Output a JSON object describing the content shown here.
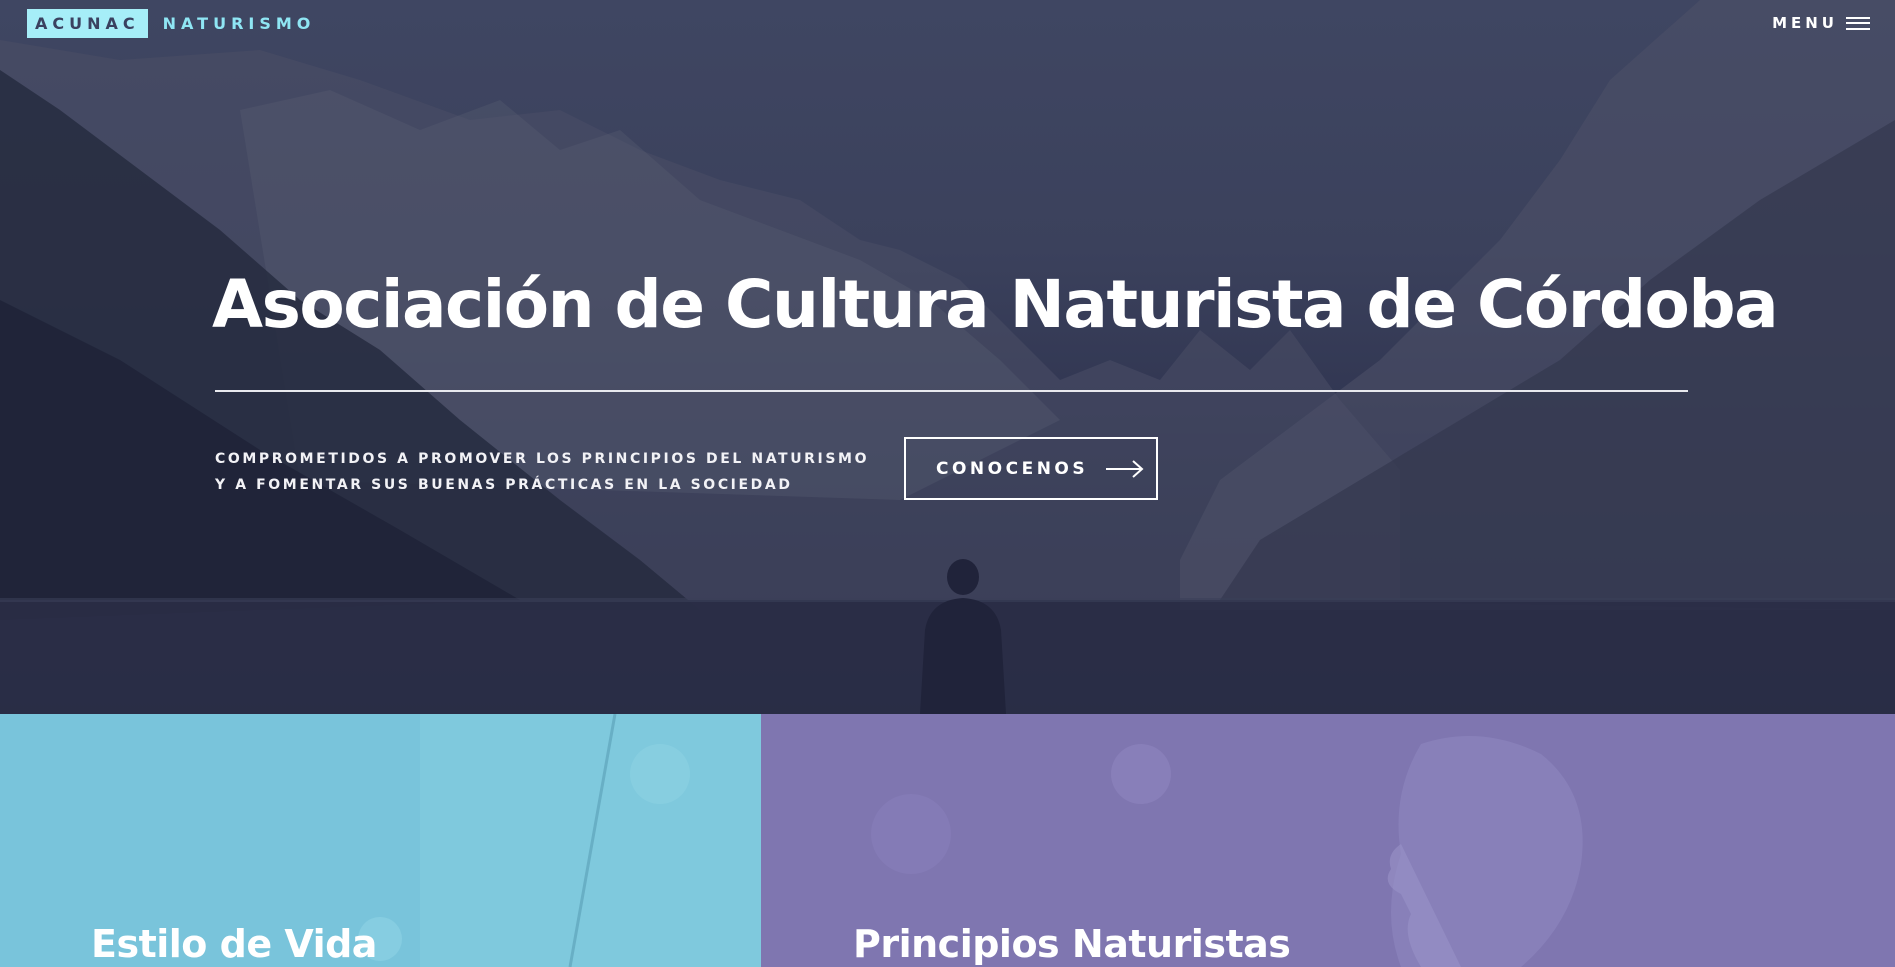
{
  "brand": {
    "box_text": "ACUNAC",
    "name": "NATURISMO"
  },
  "nav": {
    "menu_label": "MENU",
    "menu_icon": "hamburger-icon"
  },
  "hero": {
    "title": "Asociación de Cultura Naturista de Córdoba",
    "tagline_line1": "COMPROMETIDOS A PROMOVER LOS PRINCIPIOS DEL NATURISMO",
    "tagline_line2": "Y A FOMENTAR SUS BUENAS PRÁCTICAS EN LA SOCIEDAD",
    "cta_label": "CONOCENOS",
    "cta_icon": "arrow-right-icon"
  },
  "panels": [
    {
      "title": "Estilo de Vida",
      "color": "#79c4db"
    },
    {
      "title": "Principios Naturistas",
      "color": "#7f76b0"
    }
  ],
  "colors": {
    "accent": "#a6eef8",
    "hero_overlay": "#3b415c"
  }
}
